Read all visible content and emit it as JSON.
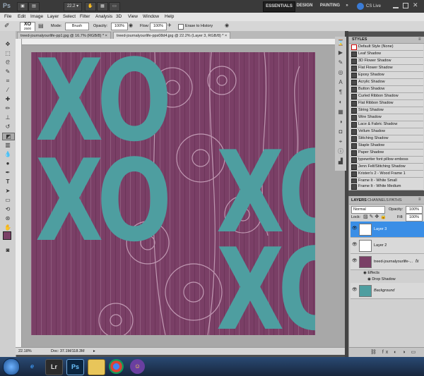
{
  "app": {
    "logo": "Ps",
    "zoom": "22.2"
  },
  "workspace": {
    "essentials": "ESSENTIALS",
    "design": "DESIGN",
    "painting": "PAINTING",
    "more": "»",
    "cs_live": "CS Live"
  },
  "menu": [
    "File",
    "Edit",
    "Image",
    "Layer",
    "Select",
    "Filter",
    "Analysis",
    "3D",
    "View",
    "Window",
    "Help"
  ],
  "options": {
    "brush_size": "2500",
    "mode_label": "Mode:",
    "mode_value": "Brush",
    "opacity_label": "Opacity:",
    "opacity_value": "100%",
    "flow_label": "Flow:",
    "flow_value": "100%",
    "erase_history": "Erase to History"
  },
  "tabs": [
    {
      "label": "treed-journalyourlife-pp1.jpg @ 16.7% (RGB/8) *",
      "close": "×"
    },
    {
      "label": "treed-journalyourlife-pps08d4.jpg @ 22.2% (Layer 3, RGB/8) *",
      "close": "×"
    }
  ],
  "artwork": {
    "top_left": "XO",
    "mid_left": "XO",
    "mid_right": "XO",
    "bottom_right": "XO"
  },
  "status": {
    "zoom": "22.18%",
    "doc": "Doc: 37.1M/118.3M"
  },
  "styles": {
    "tab": "STYLES",
    "items": [
      "Default Style (None)",
      "Leaf Shadow",
      "3D Flower Shadow",
      "Flat Flower Shadow",
      "Epoxy Shadow",
      "Acrylic Shadow",
      "Button Shadow",
      "Curled Ribbon Shadow",
      "Flat Ribbon Shadow",
      "String Shadow",
      "Wire Shadow",
      "Lace & Fabric Shadow",
      "Vellum Shadow",
      "Stitching Shadow",
      "Staple Shadow",
      "Paper Shadow",
      "typewriter font pillow emboss",
      "Jenn Felt/Stitching Shadow",
      "Kristen's 2 - Wood Frame 1",
      "Frame It - White Small",
      "Frame It - White Medium"
    ]
  },
  "layers_panel": {
    "tabs": [
      "LAYERS",
      "CHANNELS",
      "PATHS"
    ],
    "blend_mode": "Normal",
    "opacity_label": "Opacity:",
    "opacity_value": "100%",
    "lock_label": "Lock:",
    "fill_label": "Fill:",
    "fill_value": "100%",
    "layers": [
      {
        "name": "Layer 3"
      },
      {
        "name": "Layer 2"
      },
      {
        "name": "treed-journalyourlife-...",
        "fx": "fx"
      },
      {
        "name": "Background"
      }
    ],
    "effects_label": "Effects",
    "drop_shadow_label": "Drop Shadow"
  },
  "taskbar": {
    "lightroom": "Lr",
    "photoshop": "Ps"
  },
  "colors": {
    "paper": "#7a3f66",
    "letters": "#4e9ea0",
    "selection": "#3a8ee6"
  }
}
